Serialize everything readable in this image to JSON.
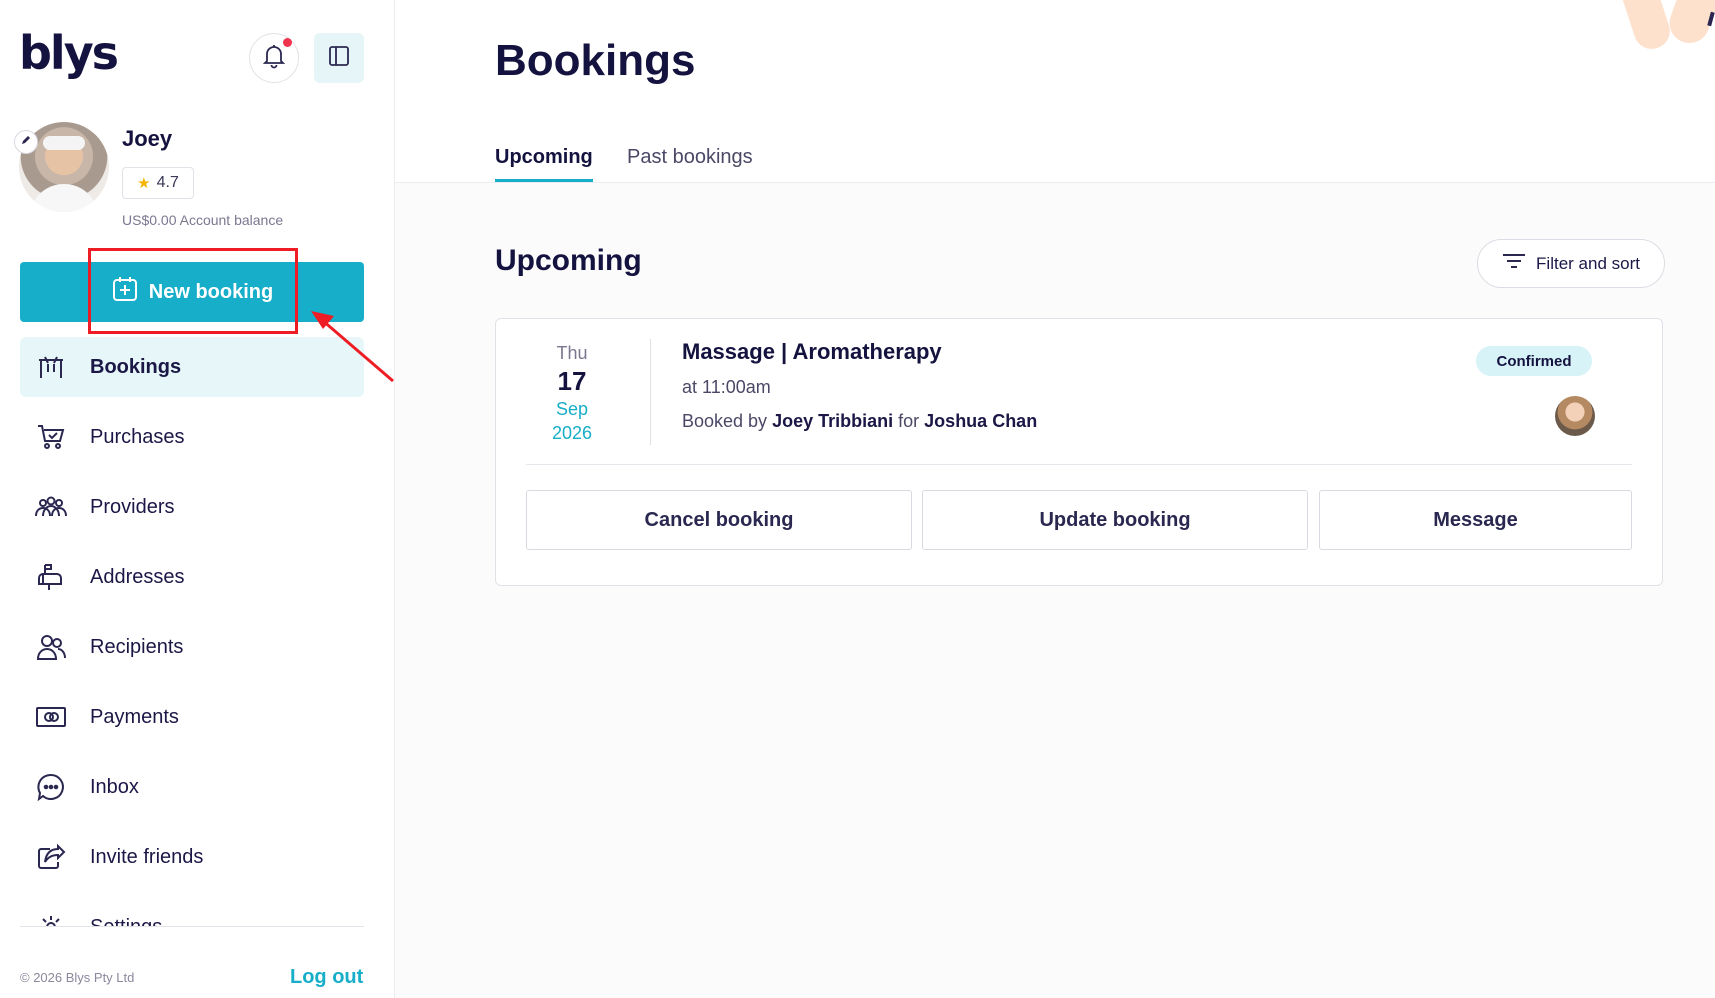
{
  "brand": {
    "logo": "blys"
  },
  "user": {
    "name": "Joey",
    "rating": "4.7",
    "balance": "US$0.00 Account balance"
  },
  "sidebar": {
    "new_booking_label": "New booking",
    "items": [
      {
        "label": "Bookings",
        "icon": "calendar-table-icon",
        "active": true
      },
      {
        "label": "Purchases",
        "icon": "cart-icon"
      },
      {
        "label": "Providers",
        "icon": "group-icon"
      },
      {
        "label": "Addresses",
        "icon": "mailbox-icon"
      },
      {
        "label": "Recipients",
        "icon": "users-icon"
      },
      {
        "label": "Payments",
        "icon": "banknote-icon"
      },
      {
        "label": "Inbox",
        "icon": "chat-icon"
      },
      {
        "label": "Invite friends",
        "icon": "share-icon"
      },
      {
        "label": "Settings",
        "icon": "settings-icon"
      }
    ],
    "copyright": "© 2026 Blys Pty Ltd",
    "logout_label": "Log out"
  },
  "header": {
    "title": "Bookings",
    "tabs": [
      {
        "label": "Upcoming",
        "active": true
      },
      {
        "label": "Past bookings",
        "active": false
      }
    ]
  },
  "section": {
    "title": "Upcoming",
    "filter_label": "Filter and sort"
  },
  "booking": {
    "date": {
      "dow": "Thu",
      "day": "17",
      "month": "Sep",
      "year": "2026"
    },
    "service": "Massage | Aromatherapy",
    "time": "at 11:00am",
    "booked_by_prefix": "Booked by",
    "booked_by": "Joey Tribbiani",
    "for_word": "for",
    "recipient": "Joshua Chan",
    "status": "Confirmed",
    "actions": {
      "cancel": "Cancel booking",
      "update": "Update booking",
      "message": "Message"
    }
  },
  "colors": {
    "accent": "#16aec8",
    "text": "#14123e",
    "highlight": "#ee1c25",
    "notification": "#f0334e"
  }
}
